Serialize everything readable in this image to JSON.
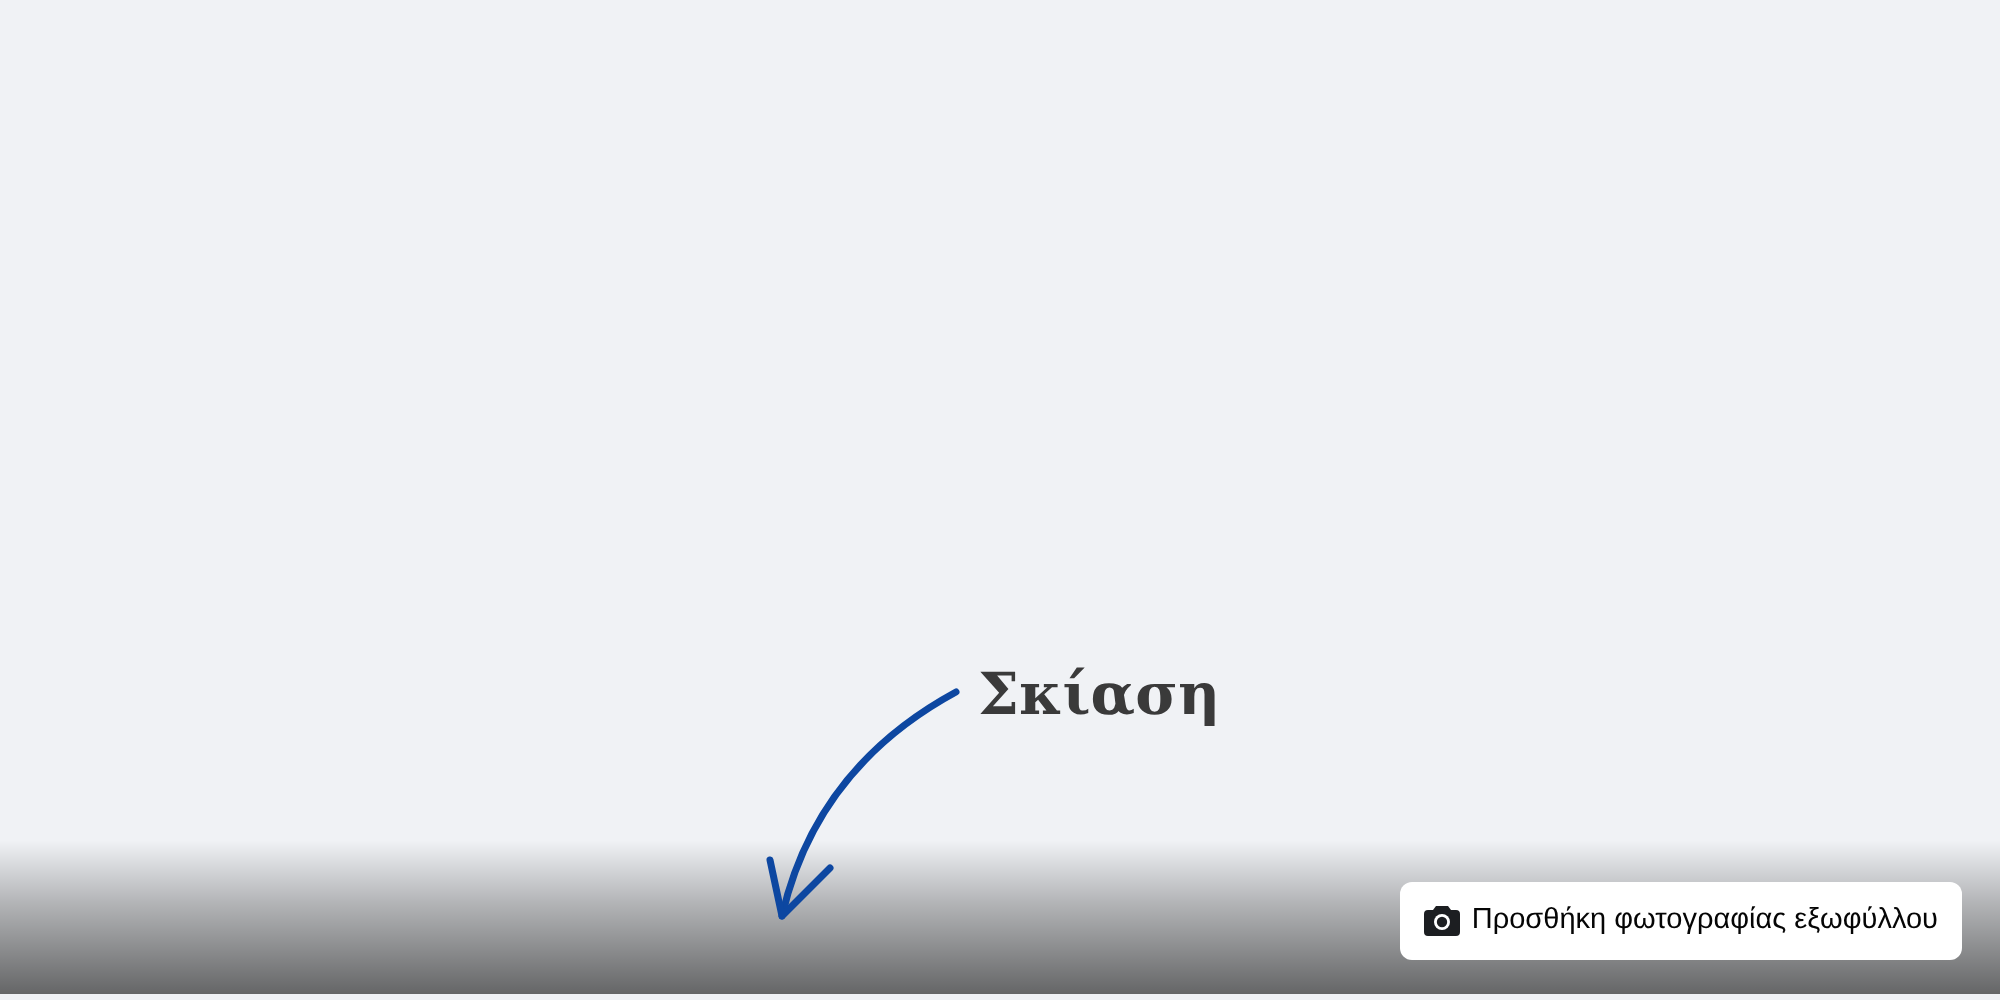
{
  "annotation": {
    "label": "Σκίαση"
  },
  "cover": {
    "button": {
      "label": "Προσθήκη φωτογραφίας εξωφύλλου"
    }
  }
}
